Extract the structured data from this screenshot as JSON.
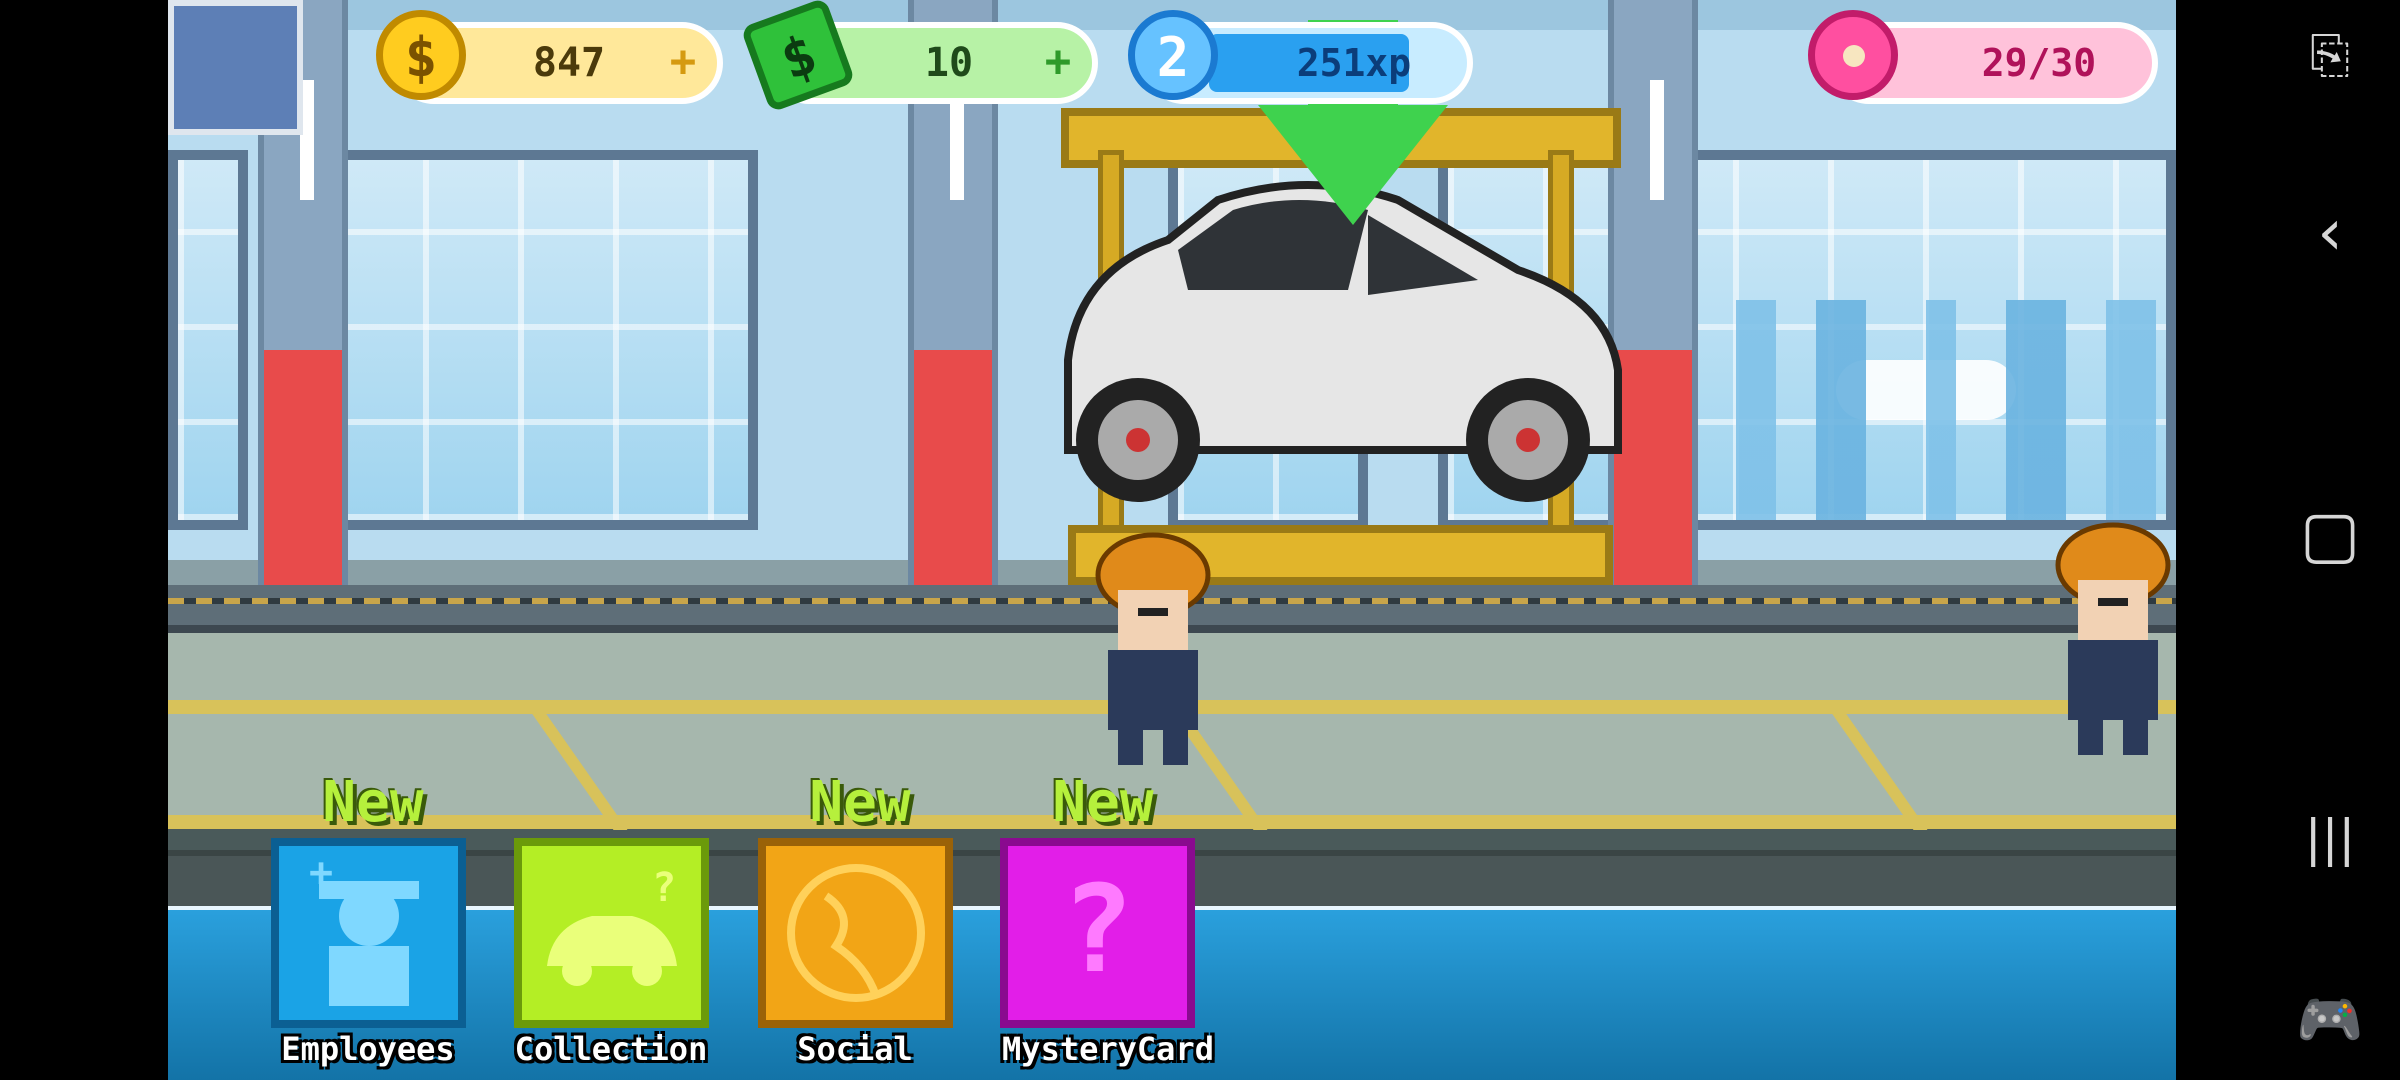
{
  "hud": {
    "coins": "847",
    "cash": "10",
    "level": "2",
    "xp": "251xp",
    "donuts": "29/30",
    "coin_plus": "+",
    "cash_plus": "+",
    "xp_fill_fraction": 0.8
  },
  "menu": {
    "new_badge": "New",
    "items": [
      {
        "label": "Employees",
        "color": "#1aa3e6",
        "has_new": true
      },
      {
        "label": "Collection",
        "color": "#b4ee25",
        "has_new": false
      },
      {
        "label": "Social",
        "color": "#f2a516",
        "has_new": true
      },
      {
        "label": "MysteryCard",
        "color": "#e21ee8",
        "has_new": true
      }
    ]
  },
  "glyphs": {
    "mystery": "?",
    "gear": "✱",
    "close": "✕",
    "back": "‹",
    "home": "▢",
    "recents": "|||"
  },
  "colors": {
    "coin": "#ffcc1f",
    "cash": "#2fc13a",
    "xp": "#2aa0f0",
    "donut": "#ff4fa0"
  }
}
